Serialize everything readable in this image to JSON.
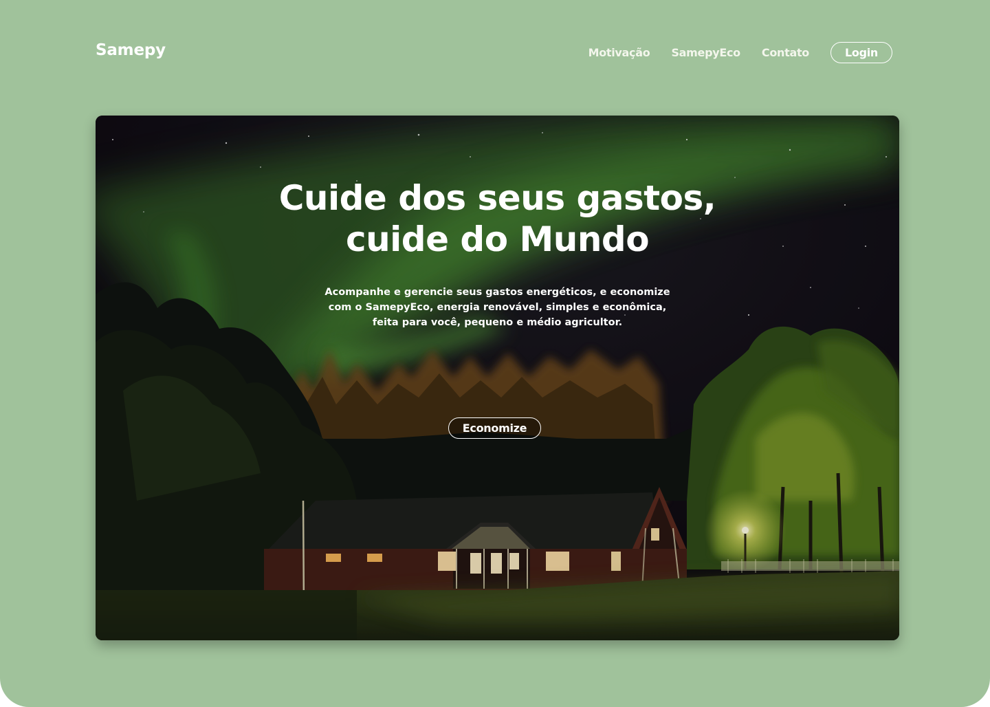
{
  "header": {
    "brand": "Samepy",
    "nav": {
      "items": [
        "Motivação",
        "SamepyEco",
        "Contato"
      ],
      "login_label": "Login"
    }
  },
  "hero": {
    "title_line1": "Cuide dos seus gastos,",
    "title_line2": "cuide do Mundo",
    "subtitle": "Acompanhe e gerencie seus gastos energéticos, e economize com o SamepyEco, energia renovável, simples e econômica, feita para você, pequeno e médio agricultor.",
    "cta_label": "Economize",
    "background_image": "night-sky-aurora-cabin-forest"
  },
  "colors": {
    "page_background": "#a0c29b",
    "text_light": "#ffffff",
    "aurora_green": "#3f8a2e"
  }
}
